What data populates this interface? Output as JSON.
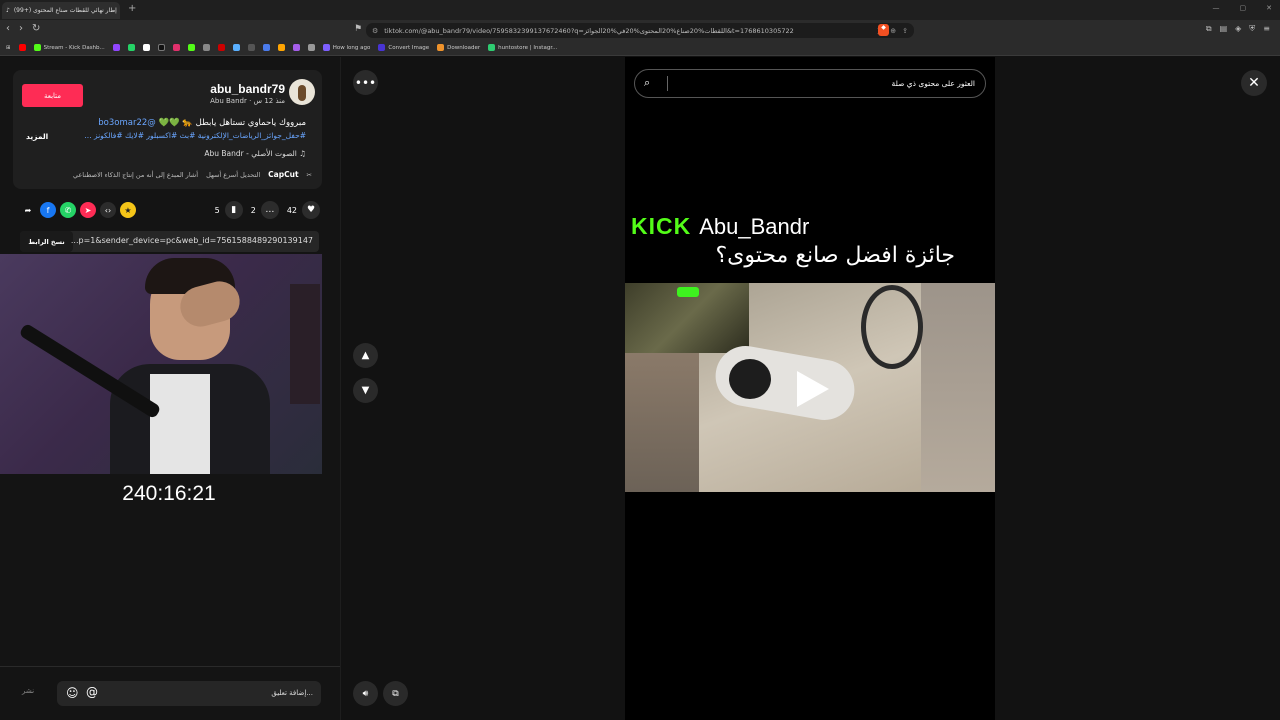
{
  "browser": {
    "tab_title": "(99+) إطار نهائي للقطات صناع المحتوى",
    "url": "tiktok.com/@abu_bandr79/video/7595832399137672460?q=اللقطات%20صناع%20المحتوى%20في%20الجوائز&t=1768610305722",
    "bookmarks": [
      "Stream - Kick Dashb...",
      "How long ago",
      "Convert Image",
      "Downloader",
      "huntostore | Instagr..."
    ]
  },
  "post": {
    "username": "abu_bandr79",
    "display_name_line": "Abu Bandr · منذ 12 س",
    "follow_label": "متابعة",
    "caption_line1": "مبرووك ياحماوي تستاهل يابطل 🐆 💚💚",
    "mention": "@bo3omar22",
    "hashtags": "#حفل_جوائز_الرياضات_الإلكترونية #بث #اكسبلور #لايك #فالكونز ...",
    "more_label": "المزيد",
    "music": "الصوت الأصلي - Abu Bandr",
    "capcut_brand": "CapCut",
    "capcut_text": "التحديل أسرع أسهل",
    "ai_note": "أشار المبدع إلى أنه من إنتاج الذكاء الاصطناعي",
    "likes": "42",
    "comments": "2",
    "saves": "5",
    "copy_link_label": "نسخ الرابط",
    "link_text": "...p=1&sender_device=pc&web_id=7561588489290139147",
    "timer": "240:16:21",
    "post_label": "نشر",
    "comment_placeholder": "إضافة تعليق..."
  },
  "player": {
    "search_placeholder": "العثور على محتوى ذي صلة",
    "kick_logo": "KICK",
    "kick_name": "Abu_Bandr",
    "award_title": "جائزة  افضل  صانع  محتوى؟"
  },
  "colors": {
    "accent": "#fe2c55",
    "kick_green": "#53fc18",
    "link_blue": "#6aa6ff"
  }
}
